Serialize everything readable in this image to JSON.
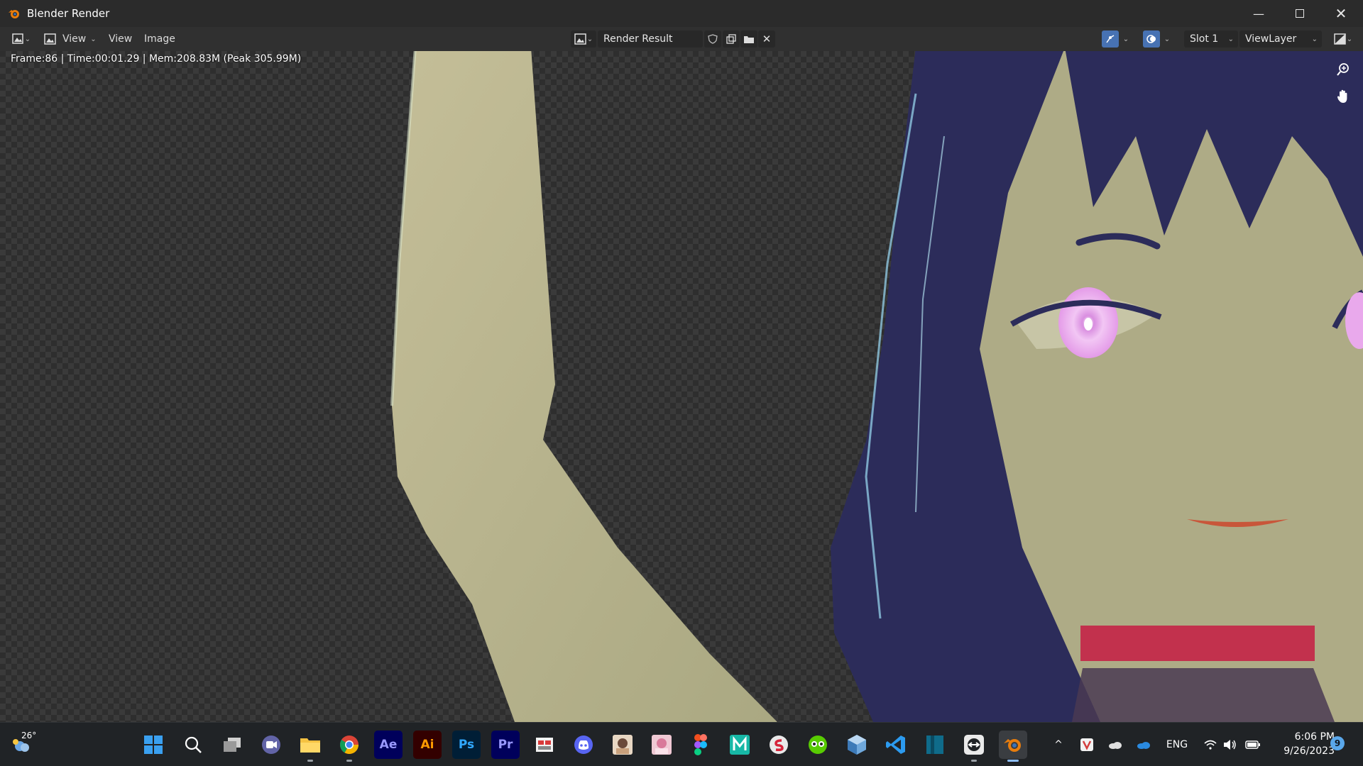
{
  "window": {
    "title": "Blender Render",
    "minimize_icon": "minimize-icon",
    "maximize_icon": "maximize-icon",
    "close_icon": "close-icon"
  },
  "header": {
    "editor_type_icon": "image-editor-icon",
    "mode_icon": "view-mode-icon",
    "mode_label": "View",
    "menus": [
      "View",
      "Image"
    ],
    "image_name": "Render Result",
    "slot": "Slot 1",
    "view_layer": "ViewLayer"
  },
  "stats": "Frame:86 | Time:00:01.29 | Mem:208.83M (Peak 305.99M)",
  "taskbar": {
    "weather_temp": "26°",
    "apps": [
      "Start",
      "Search",
      "Task View",
      "Meet",
      "File Explorer",
      "Chrome",
      "After Effects",
      "Illustrator",
      "Photoshop",
      "Premiere Pro",
      "App",
      "Discord",
      "App",
      "App",
      "Figma",
      "Media Encoder",
      "App",
      "Duolingo",
      "App",
      "VS Code",
      "App",
      "App",
      "Blender"
    ],
    "labels": {
      "ae": "Ae",
      "ai": "Ai",
      "ps": "Ps",
      "pr": "Pr"
    },
    "language": "ENG",
    "time": "6:06 PM",
    "date": "9/26/2023",
    "notifications": "9"
  },
  "colors": {
    "titlebar": "#2b2b2b",
    "header": "#303030",
    "taskbar": "#202326",
    "accent": "#4772b3"
  }
}
